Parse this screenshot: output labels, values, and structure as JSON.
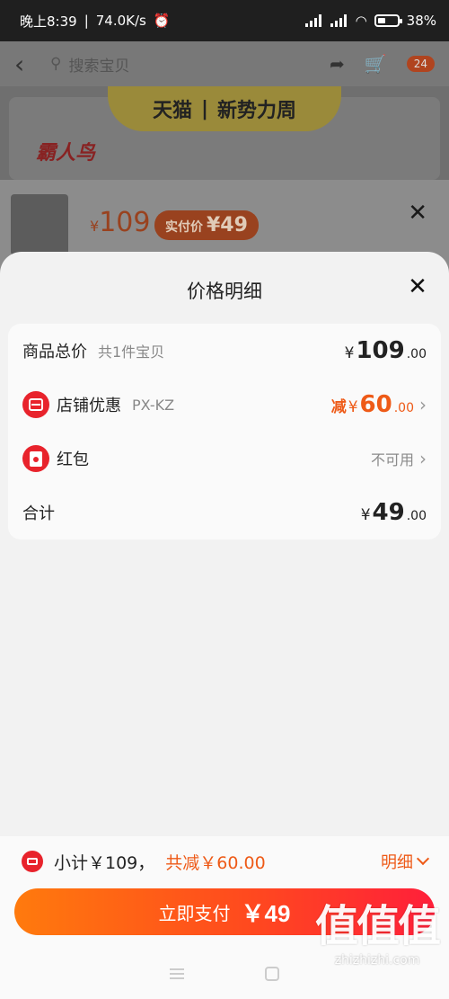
{
  "status_bar": {
    "time": "晚上8:39",
    "speed": "74.0K/s",
    "battery": "38%"
  },
  "background_page": {
    "search_placeholder": "搜索宝贝",
    "cart_badge": "24",
    "banner_brand": "霸人鸟",
    "banner_tmall": "天猫",
    "banner_campaign": "新势力周",
    "product_price_symbol": "¥",
    "product_price": "109",
    "real_price_label": "实付价",
    "real_price": "¥49"
  },
  "sheet": {
    "title": "价格明细",
    "rows": {
      "total": {
        "label": "商品总价",
        "sub": "共1件宝贝",
        "yen": "¥",
        "integer": "109",
        "decimal": ".00"
      },
      "shop_discount": {
        "label": "店铺优惠",
        "sub": "PX-KZ",
        "prefix": "减",
        "yen": "¥",
        "integer": "60",
        "decimal": ".00"
      },
      "red_packet": {
        "label": "红包",
        "status": "不可用"
      },
      "sum": {
        "label": "合计",
        "yen": "¥",
        "integer": "49",
        "decimal": ".00"
      }
    }
  },
  "footer": {
    "subtotal": "小计￥109，",
    "discount": "共减￥60.00",
    "detail_toggle": "明细",
    "pay_label": "立即支付",
    "pay_amount": "￥49"
  },
  "watermark": {
    "glyphs": "值值值",
    "url": "zhizhizhi.com"
  },
  "colors": {
    "accent": "#ee5a17",
    "icon_red": "#e8232c"
  }
}
